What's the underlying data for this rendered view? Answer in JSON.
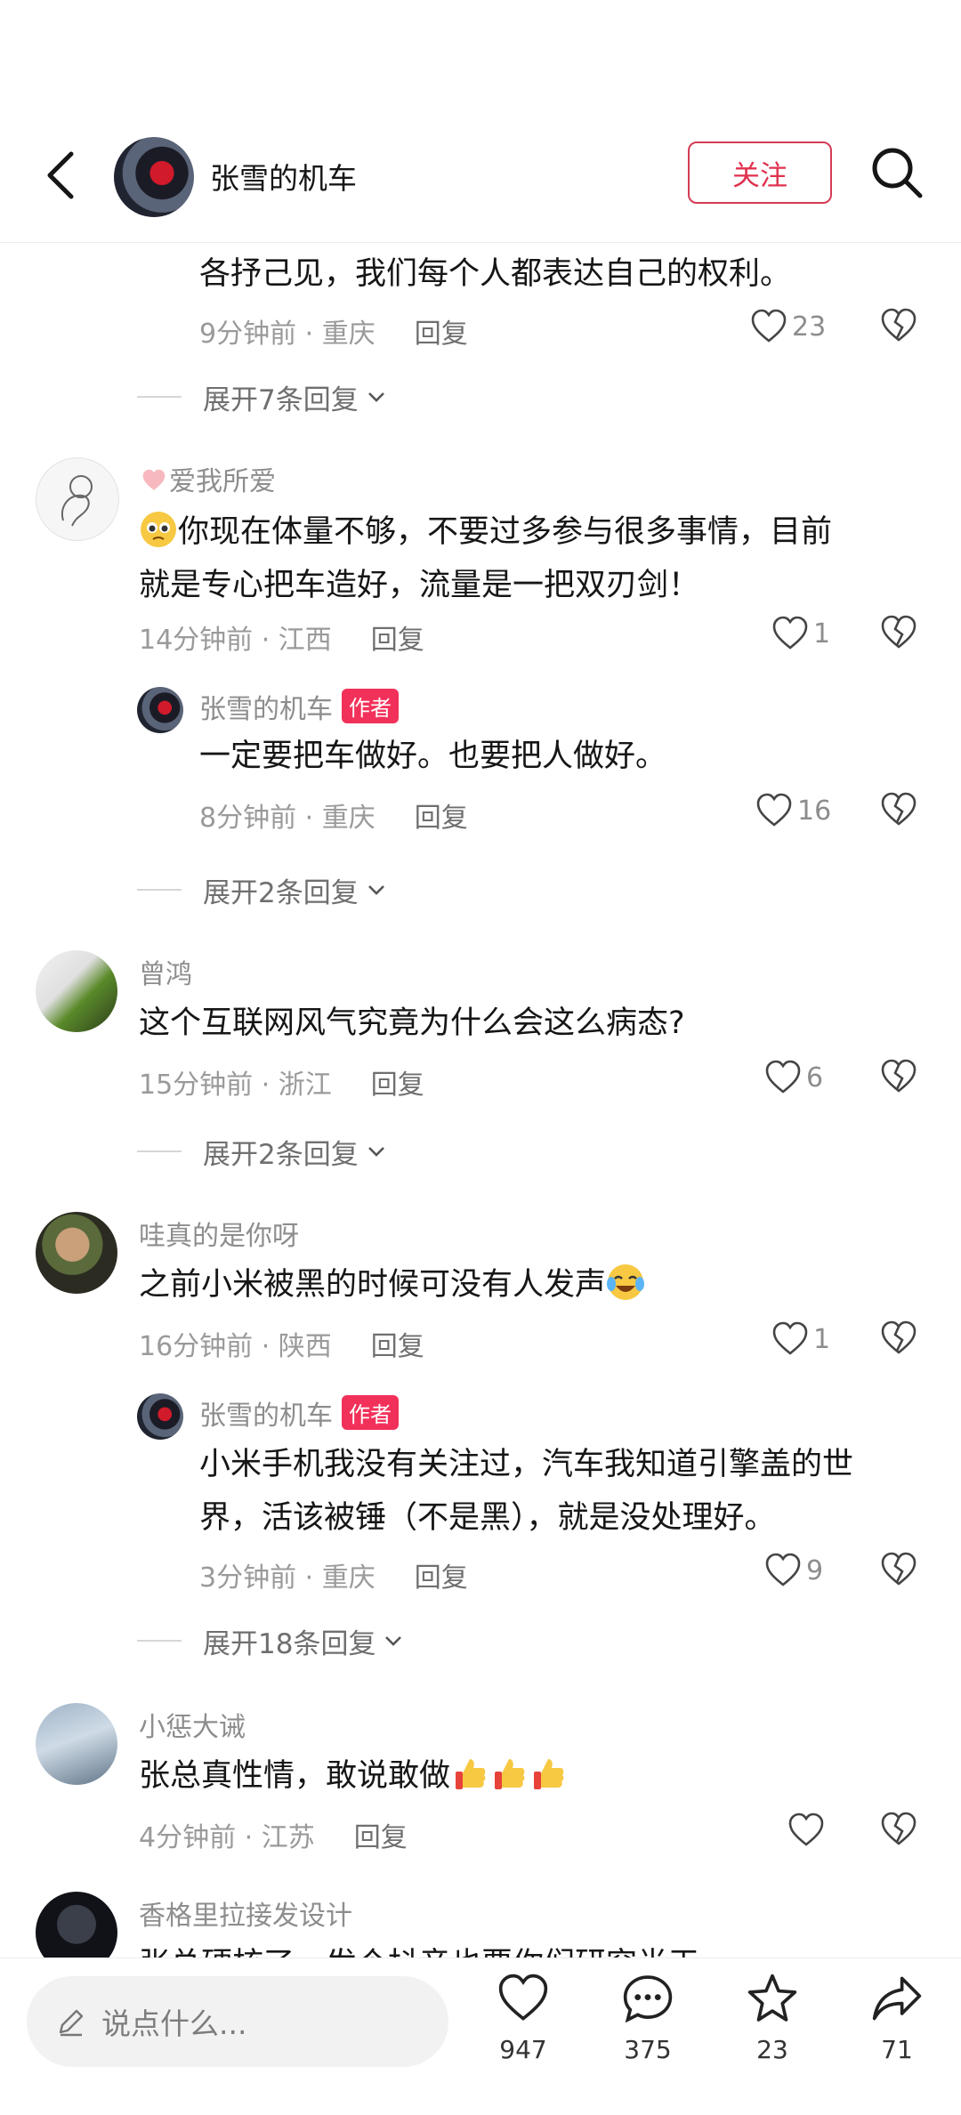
{
  "header": {
    "title": "张雪的机车",
    "follow_label": "关注"
  },
  "comments": [
    {
      "text": "各抒己见，我们每个人都表达自己的权利。",
      "time": "9分钟前 · 重庆",
      "reply": "回复",
      "likes": "23",
      "expand": "展开7条回复"
    },
    {
      "user": "爱我所爱",
      "text1": "你现在体量不够，不要过多参与很多事情，目前",
      "text2": "就是专心把车造好，流量是一把双刃剑！",
      "time": "14分钟前 · 江西",
      "reply": "回复",
      "likes": "1"
    },
    {
      "user": "张雪的机车",
      "badge": "作者",
      "text": "一定要把车做好。也要把人做好。",
      "time": "8分钟前 · 重庆",
      "reply": "回复",
      "likes": "16",
      "expand": "展开2条回复"
    },
    {
      "user": "曾鸿",
      "text": "这个互联网风气究竟为什么会这么病态?",
      "time": "15分钟前 · 浙江",
      "reply": "回复",
      "likes": "6",
      "expand": "展开2条回复"
    },
    {
      "user": "哇真的是你呀",
      "text": "之前小米被黑的时候可没有人发声",
      "time": "16分钟前 · 陕西",
      "reply": "回复",
      "likes": "1"
    },
    {
      "user": "张雪的机车",
      "badge": "作者",
      "text1": "小米手机我没有关注过，汽车我知道引擎盖的世",
      "text2": "界，活该被锤（不是黑），就是没处理好。",
      "time": "3分钟前 · 重庆",
      "reply": "回复",
      "likes": "9",
      "expand": "展开18条回复"
    },
    {
      "user": "小惩大诫",
      "text": "张总真性情，敢说敢做",
      "time": "4分钟前 · 江苏",
      "reply": "回复"
    },
    {
      "user": "香格里拉接发设计",
      "text": "张总硬核了，发个抖音也要你们研究半天"
    }
  ],
  "bottom": {
    "placeholder": "说点什么...",
    "likes": "947",
    "comments": "375",
    "favorites": "23",
    "shares": "71"
  }
}
